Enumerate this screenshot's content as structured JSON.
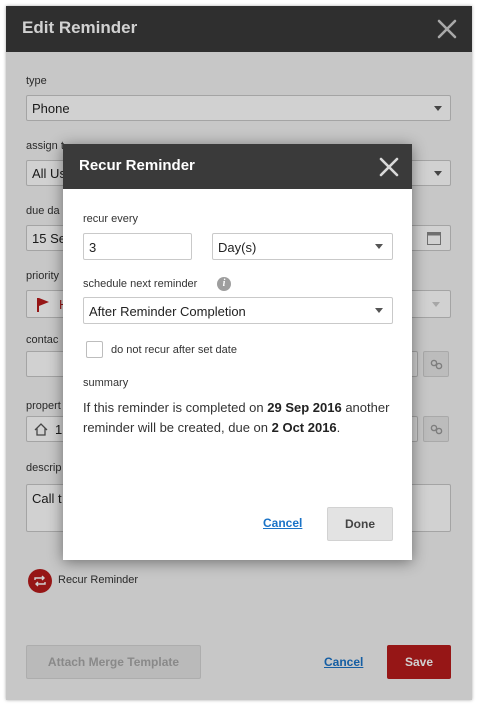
{
  "panel": {
    "title": "Edit Reminder",
    "close_icon": "close-icon",
    "fields": {
      "type": {
        "label": "type",
        "value": "Phone"
      },
      "assign": {
        "label": "assign t",
        "value": "All Us"
      },
      "due_date": {
        "label": "due da",
        "value": "15 Se"
      },
      "priority": {
        "label": "priority",
        "value": "H"
      },
      "contact": {
        "label": "contac",
        "value": ""
      },
      "property": {
        "label": "propert",
        "value": "1"
      },
      "description": {
        "label": "descrip",
        "value": "Call t"
      }
    },
    "recur_label": "Recur Reminder",
    "attach_label": "Attach Merge Template",
    "cancel_label": "Cancel",
    "save_label": "Save"
  },
  "modal": {
    "title": "Recur Reminder",
    "recur_every_label": "recur every",
    "recur_every_value": "3",
    "unit_value": "Day(s)",
    "schedule_label": "schedule next reminder",
    "schedule_value": "After Reminder Completion",
    "info_glyph": "i",
    "checkbox_label": "do not recur after set date",
    "checkbox_checked": false,
    "summary_label": "summary",
    "summary": {
      "p1": "If this reminder is completed on ",
      "d1": "29 Sep 2016",
      "p2": " another reminder will be created, due on ",
      "d2": "2 Oct 2016",
      "p3": "."
    },
    "cancel_label": "Cancel",
    "done_label": "Done"
  },
  "colors": {
    "header_bg": "#3a3a3a",
    "accent_red": "#b71c1c",
    "link_blue": "#1a73c7",
    "panel_bg": "#f3f3f3"
  }
}
